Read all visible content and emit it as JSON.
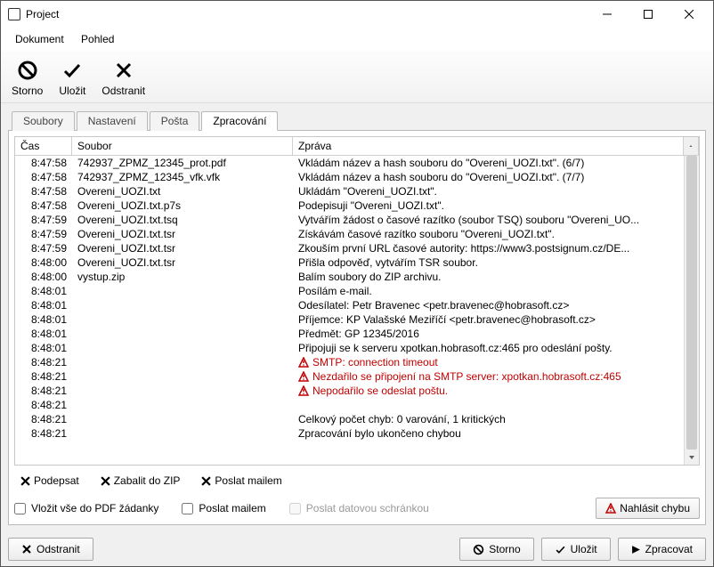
{
  "window": {
    "title": "Project"
  },
  "menu": {
    "dokument": "Dokument",
    "pohled": "Pohled"
  },
  "toolbar": {
    "storno": "Storno",
    "ulozit": "Uložit",
    "odstranit": "Odstranit"
  },
  "tabs": {
    "soubory": "Soubory",
    "nastaveni": "Nastavení",
    "posta": "Pošta",
    "zpracovani": "Zpracování"
  },
  "columns": {
    "cas": "Čas",
    "soubor": "Soubor",
    "zprava": "Zpráva"
  },
  "rows": [
    {
      "t": "8:47:58",
      "f": "742937_ZPMZ_12345_prot.pdf",
      "m": "Vkládám název a hash souboru do \"Overeni_UOZI.txt\". (6/7)"
    },
    {
      "t": "8:47:58",
      "f": "742937_ZPMZ_12345_vfk.vfk",
      "m": "Vkládám název a hash souboru do \"Overeni_UOZI.txt\". (7/7)"
    },
    {
      "t": "8:47:58",
      "f": "Overeni_UOZI.txt",
      "m": "Ukládám \"Overeni_UOZI.txt\"."
    },
    {
      "t": "8:47:58",
      "f": "Overeni_UOZI.txt.p7s",
      "m": "Podepisuji \"Overeni_UOZI.txt\"."
    },
    {
      "t": "8:47:59",
      "f": "Overeni_UOZI.txt.tsq",
      "m": "Vytvářím žádost o časové razítko (soubor TSQ) souboru \"Overeni_UO..."
    },
    {
      "t": "8:47:59",
      "f": "Overeni_UOZI.txt.tsr",
      "m": "Získávám časové razítko souboru \"Overeni_UOZI.txt\"."
    },
    {
      "t": "8:47:59",
      "f": "Overeni_UOZI.txt.tsr",
      "m": "Zkouším první URL časové autority: https://www3.postsignum.cz/DE..."
    },
    {
      "t": "8:48:00",
      "f": "Overeni_UOZI.txt.tsr",
      "m": "Přišla odpověď, vytvářím TSR soubor."
    },
    {
      "t": "8:48:00",
      "f": "vystup.zip",
      "m": "Balím soubory do ZIP archivu."
    },
    {
      "t": "8:48:01",
      "f": "",
      "m": "Posílám e-mail."
    },
    {
      "t": "8:48:01",
      "f": "",
      "m": "Odesílatel: Petr Bravenec <petr.bravenec@hobrasoft.cz>"
    },
    {
      "t": "8:48:01",
      "f": "",
      "m": "Příjemce: KP Valašské Meziříčí <petr.bravenec@hobrasoft.cz>"
    },
    {
      "t": "8:48:01",
      "f": "",
      "m": "Předmět: GP 12345/2016"
    },
    {
      "t": "8:48:01",
      "f": "",
      "m": "Připojuji se k serveru xpotkan.hobrasoft.cz:465 pro odeslání pošty."
    },
    {
      "t": "8:48:21",
      "f": "",
      "m": "SMTP: connection timeout",
      "err": true
    },
    {
      "t": "8:48:21",
      "f": "",
      "m": "Nezdařilo se připojení na SMTP server: xpotkan.hobrasoft.cz:465",
      "err": true
    },
    {
      "t": "8:48:21",
      "f": "",
      "m": "Nepodařilo se odeslat poštu.",
      "err": true
    },
    {
      "t": "8:48:21",
      "f": "",
      "m": ""
    },
    {
      "t": "8:48:21",
      "f": "",
      "m": "Celkový počet chyb: 0 varování, 1 kritických"
    },
    {
      "t": "8:48:21",
      "f": "",
      "m": "Zpracování bylo ukončeno chybou"
    }
  ],
  "panelButtons": {
    "podepsat": "Podepsat",
    "zabalit": "Zabalit do ZIP",
    "poslat": "Poslat mailem"
  },
  "checks": {
    "pdf": "Vložit vše do PDF žádanky",
    "mail": "Poslat mailem",
    "datova": "Poslat datovou schránkou"
  },
  "report": "Nahlásit chybu",
  "footer": {
    "odstranit": "Odstranit",
    "storno": "Storno",
    "ulozit": "Uložit",
    "zpracovat": "Zpracovat"
  }
}
